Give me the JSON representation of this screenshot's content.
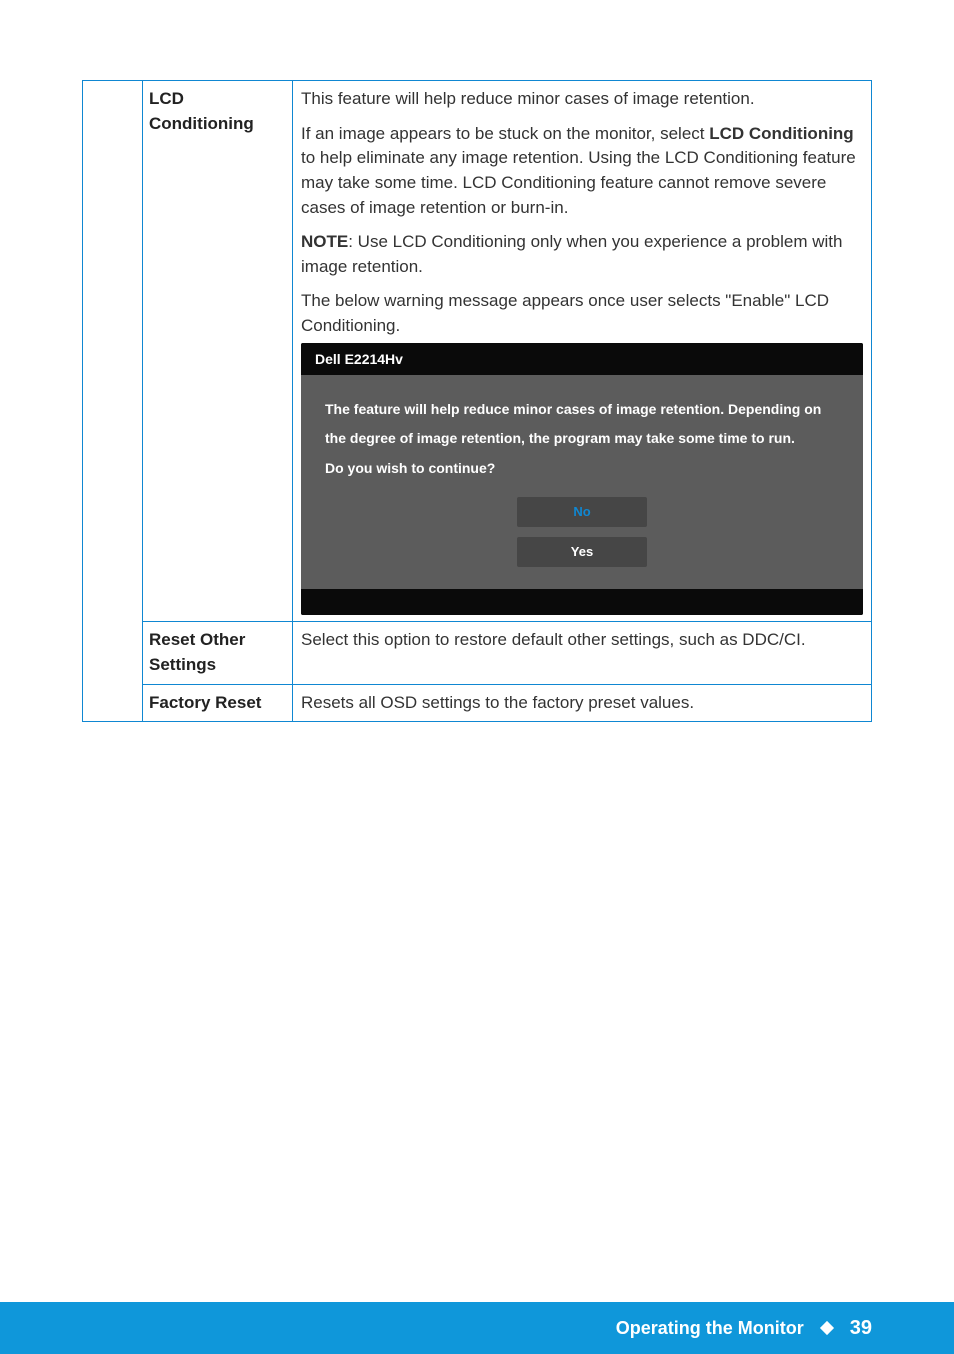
{
  "rows": {
    "lcd_conditioning": {
      "label": "LCD Conditioning",
      "p1": "This feature will help reduce minor cases of image retention.",
      "p2_a": "If an image appears to be stuck on the monitor, select ",
      "p2_b": "LCD Conditioning",
      "p2_c": " to help eliminate any image retention. Using the LCD Conditioning feature may take some time. LCD Conditioning feature cannot remove  severe cases of image retention or burn-in.",
      "p3_a": "NOTE",
      "p3_b": ": Use LCD Conditioning only when you experience a problem with image retention.",
      "p4": "The below warning message appears once user selects \"Enable\" LCD Conditioning."
    },
    "reset_other": {
      "label": "Reset Other Settings",
      "desc": "Select this option to restore default other settings, such as DDC/CI."
    },
    "factory_reset": {
      "label": "Factory Reset",
      "desc": "Resets all OSD settings to the factory preset values."
    }
  },
  "osd": {
    "title": "Dell E2214Hv",
    "line1": "The feature will help reduce minor cases of image retention. Depending on",
    "line2": "the degree of image retention, the program may take some time to run.",
    "line3": "Do you wish to continue?",
    "btn_no": "No",
    "btn_yes": "Yes"
  },
  "footer": {
    "section": "Operating the Monitor",
    "page_number": "39"
  }
}
